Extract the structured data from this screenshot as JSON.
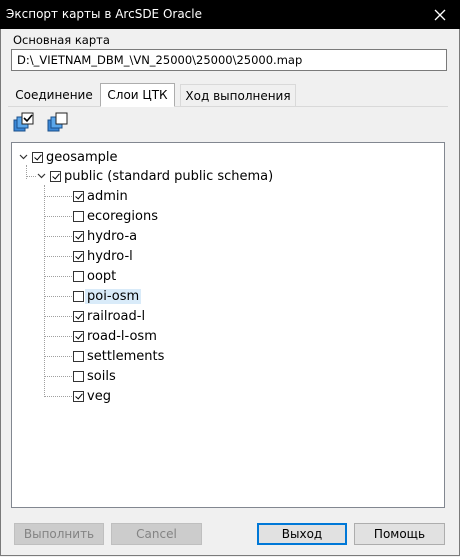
{
  "window": {
    "title": "Экспорт карты в ArcSDE Oracle",
    "close_symbol": "✕"
  },
  "main_map": {
    "label": "Основная карта",
    "path": "D:\\_VIETNAM_DBM_\\VN_25000\\25000\\25000.map"
  },
  "tabs": [
    {
      "label": "Соединение",
      "active": false
    },
    {
      "label": "Слои ЦТК",
      "active": true
    },
    {
      "label": "Ход выполнения",
      "active": false
    }
  ],
  "toolbar": [
    {
      "icon": "check-all-layers-icon"
    },
    {
      "icon": "uncheck-all-layers-icon"
    }
  ],
  "tree": {
    "root": {
      "label": "geosample",
      "checked": true,
      "expanded": true
    },
    "schema": {
      "label": "public (standard public schema)",
      "checked": true,
      "expanded": true
    },
    "layers": [
      {
        "label": "admin",
        "checked": true,
        "selected": false
      },
      {
        "label": "ecoregions",
        "checked": false,
        "selected": false
      },
      {
        "label": "hydro-a",
        "checked": true,
        "selected": false
      },
      {
        "label": "hydro-l",
        "checked": true,
        "selected": false
      },
      {
        "label": "oopt",
        "checked": false,
        "selected": false
      },
      {
        "label": "poi-osm",
        "checked": false,
        "selected": true
      },
      {
        "label": "railroad-l",
        "checked": true,
        "selected": false
      },
      {
        "label": "road-l-osm",
        "checked": true,
        "selected": false
      },
      {
        "label": "settlements",
        "checked": false,
        "selected": false
      },
      {
        "label": "soils",
        "checked": false,
        "selected": false
      },
      {
        "label": "veg",
        "checked": true,
        "selected": false
      }
    ]
  },
  "buttons": {
    "run": "Выполнить",
    "cancel": "Cancel",
    "exit": "Выход",
    "help": "Помощь"
  }
}
